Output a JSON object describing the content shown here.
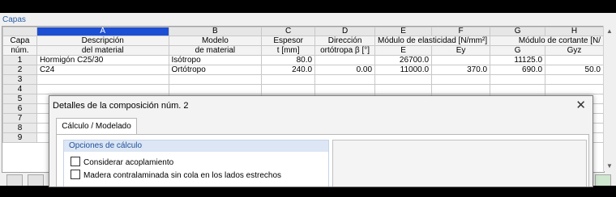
{
  "panel": {
    "title": "Capas"
  },
  "grid": {
    "col_letters": [
      "A",
      "B",
      "C",
      "D",
      "E",
      "F",
      "G",
      "H"
    ],
    "header_row1": {
      "num": "Capa",
      "desc": "Descripción",
      "model": "Modelo",
      "thick": "Espesor",
      "dir": "Dirección",
      "elastic": "Módulo de elasticidad [N/mm²]",
      "shear": "Módulo de cortante [N/"
    },
    "header_row2": {
      "num": "núm.",
      "desc": "del material",
      "model": "de material",
      "thick": "t [mm]",
      "dir": "ortótropa β [°]",
      "e": "E",
      "ey": "Ey",
      "g": "G",
      "gyz": "Gyz"
    },
    "rows": [
      {
        "n": "1",
        "desc": "Hormigón C25/30",
        "model": "Isótropo",
        "t": "80.0",
        "beta": "",
        "e": "26700.0",
        "ey": "",
        "g": "11125.0",
        "gyz": ""
      },
      {
        "n": "2",
        "desc": "C24",
        "model": "Ortótropo",
        "t": "240.0",
        "beta": "0.00",
        "e": "11000.0",
        "ey": "370.0",
        "g": "690.0",
        "gyz": "50.0"
      },
      {
        "n": "3",
        "desc": "",
        "model": "",
        "t": "",
        "beta": "",
        "e": "",
        "ey": "",
        "g": "",
        "gyz": ""
      },
      {
        "n": "4",
        "desc": "",
        "model": "",
        "t": "",
        "beta": "",
        "e": "",
        "ey": "",
        "g": "",
        "gyz": ""
      },
      {
        "n": "5",
        "desc": "",
        "model": "",
        "t": "",
        "beta": "",
        "e": "",
        "ey": "",
        "g": "",
        "gyz": ""
      },
      {
        "n": "6",
        "desc": "",
        "model": "",
        "t": "",
        "beta": "",
        "e": "",
        "ey": "",
        "g": "",
        "gyz": ""
      },
      {
        "n": "7",
        "desc": "",
        "model": "",
        "t": "",
        "beta": "",
        "e": "",
        "ey": "",
        "g": "",
        "gyz": ""
      },
      {
        "n": "8",
        "desc": "",
        "model": "",
        "t": "",
        "beta": "",
        "e": "",
        "ey": "",
        "g": "",
        "gyz": ""
      },
      {
        "n": "9",
        "desc": "",
        "model": "",
        "t": "",
        "beta": "",
        "e": "",
        "ey": "",
        "g": "",
        "gyz": ""
      }
    ]
  },
  "dialog": {
    "title": "Detalles de la composición núm. 2",
    "close": "✕",
    "tab": "Cálculo / Modelado",
    "group_title": "Opciones de cálculo",
    "options": [
      {
        "label": "Considerar acoplamiento",
        "checked": false
      },
      {
        "label": "Madera contralaminada sin cola en los lados estrechos",
        "checked": false
      }
    ]
  },
  "colors": {
    "selected_col": "#1d4fd4",
    "title_blue": "#2a5ea8"
  }
}
